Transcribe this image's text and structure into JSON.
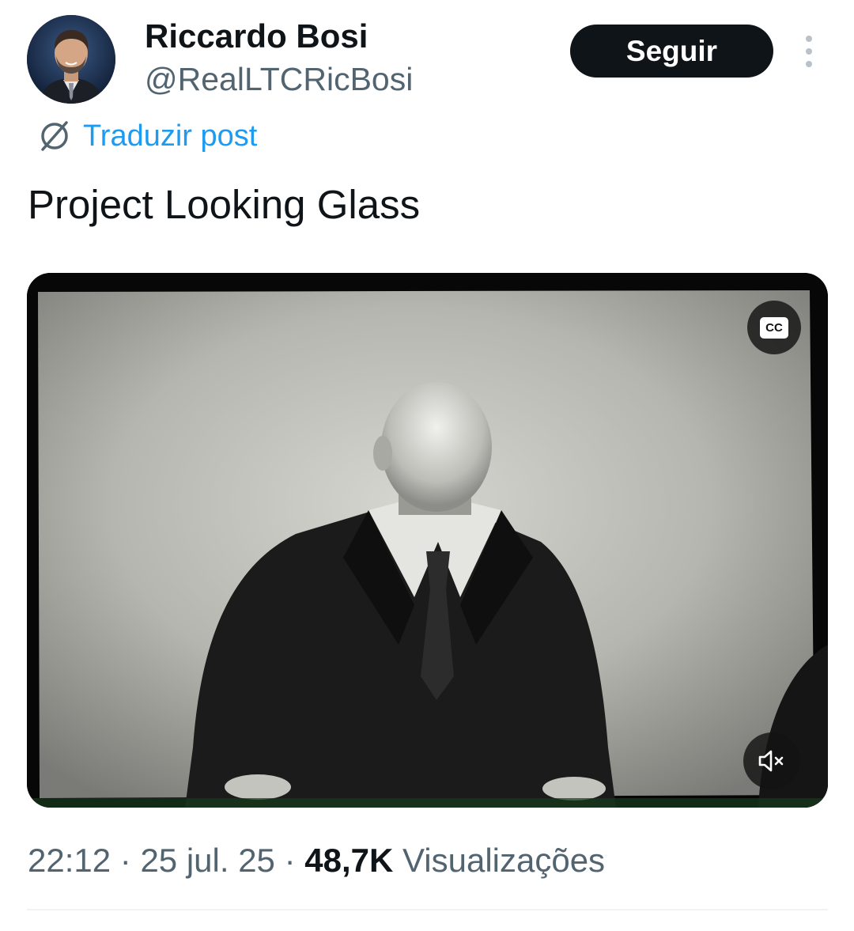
{
  "author": {
    "display_name": "Riccardo Bosi",
    "handle": "@RealLTCRicBosi"
  },
  "follow_label": "Seguir",
  "translate_label": "Traduzir post",
  "post_text": "Project Looking Glass",
  "media": {
    "cc_label": "CC",
    "muted": true
  },
  "meta": {
    "time": "22:12",
    "sep1": "·",
    "date": "25 jul. 25",
    "sep2": "·",
    "views_count": "48,7K",
    "views_label": "Visualizações"
  },
  "colors": {
    "accent": "#1d9bf0",
    "button_bg": "#0f1419",
    "secondary_text": "#536471"
  }
}
